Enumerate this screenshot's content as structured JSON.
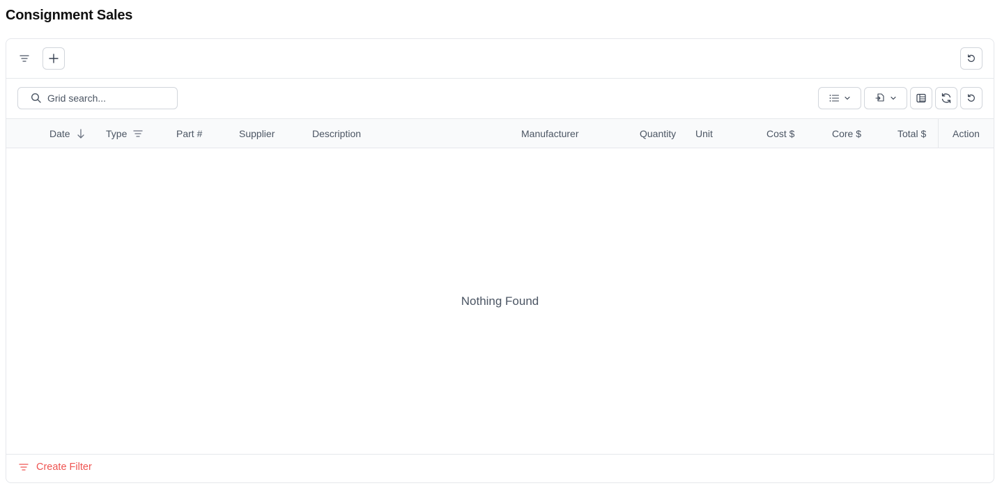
{
  "page": {
    "title": "Consignment Sales"
  },
  "toolbar": {
    "filter_icon": "filter-icon",
    "add_icon": "plus-icon",
    "reset_icon": "undo-icon"
  },
  "search": {
    "placeholder": "Grid search..."
  },
  "search_toolbar": {
    "view_icon": "list-icon",
    "export_icon": "file-icon",
    "columns_icon": "columns-icon",
    "refresh_icon": "refresh-icon",
    "reset_icon": "undo-icon"
  },
  "grid": {
    "columns": [
      {
        "label": "Date",
        "sorted": "desc"
      },
      {
        "label": "Type",
        "filter": true
      },
      {
        "label": "Part #"
      },
      {
        "label": "Supplier"
      },
      {
        "label": "Description"
      },
      {
        "label": "Manufacturer"
      },
      {
        "label": "Quantity"
      },
      {
        "label": "Unit"
      },
      {
        "label": "Cost $"
      },
      {
        "label": "Core $"
      },
      {
        "label": "Total $"
      }
    ],
    "action_label": "Action",
    "empty_text": "Nothing Found",
    "rows": []
  },
  "footer": {
    "create_filter_label": "Create Filter"
  },
  "colors": {
    "accent": "#ef5350",
    "border": "#e5e7eb",
    "header_bg": "#f9fafb",
    "muted_text": "#4b5563"
  }
}
